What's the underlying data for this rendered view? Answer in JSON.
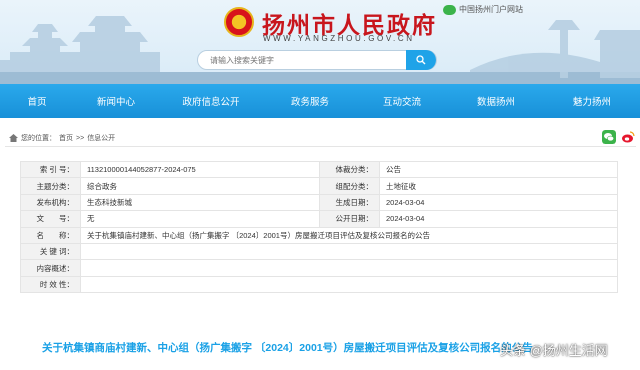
{
  "header": {
    "site_link": "中国扬州门户网站",
    "site_title": "扬州市人民政府",
    "domain": "WWW.YANGZHOU.GOV.CN",
    "search_placeholder": "请输入搜索关键字"
  },
  "nav": {
    "items": [
      "首页",
      "新闻中心",
      "政府信息公开",
      "政务服务",
      "互动交流",
      "数据扬州",
      "魅力扬州"
    ]
  },
  "breadcrumb": {
    "prefix": "您的位置：",
    "home": "首页",
    "sep": ">>",
    "current": "信息公开"
  },
  "info_table": {
    "rows": [
      {
        "k1": "索 引 号：",
        "v1": "113210000144052877-2024-075",
        "k2": "体裁分类：",
        "v2": "公告"
      },
      {
        "k1": "主题分类：",
        "v1": "综合政务",
        "k2": "组配分类：",
        "v2": "土地征收"
      },
      {
        "k1": "发布机构：",
        "v1": "生态科技新城",
        "k2": "生成日期：",
        "v2": "2024-03-04"
      },
      {
        "k1": "文　　号：",
        "v1": "无",
        "k2": "公开日期：",
        "v2": "2024-03-04"
      }
    ],
    "name_label": "名　　称：",
    "name_value": "关于杭集镇庙村建新、中心组（扬广集搬字 〔2024〕2001号）房屋搬迁项目评估及复核公司报名的公告",
    "keywords_label": "关 键 词：",
    "keywords_value": "",
    "summary_label": "内容概述：",
    "summary_value": "",
    "timeliness_label": "时 效 性：",
    "timeliness_value": ""
  },
  "document": {
    "title": "关于杭集镇商庙村建新、中心组（扬广集搬字 〔2024〕2001号）房屋搬迁项目评估及复核公司报名的公告"
  },
  "watermark": "头条 @扬州生活网",
  "colors": {
    "nav_blue": "#1c98de",
    "title_red": "#c8161d",
    "doc_title_blue": "#1aa1e6"
  }
}
